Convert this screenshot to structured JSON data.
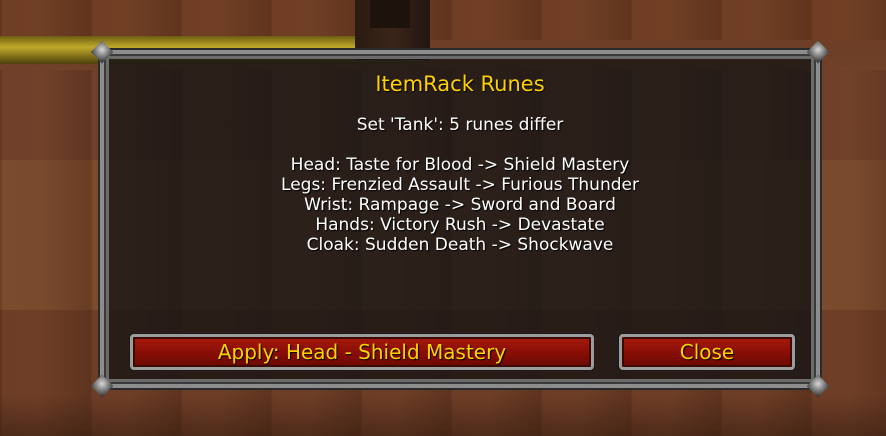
{
  "dialog": {
    "title": "ItemRack Runes",
    "subtitle": "Set 'Tank': 5 runes differ",
    "rune_changes": [
      "Head: Taste for Blood -> Shield Mastery",
      "Legs: Frenzied Assault -> Furious Thunder",
      "Wrist: Rampage -> Sword and Board",
      "Hands: Victory Rush -> Devastate",
      "Cloak: Sudden Death -> Shockwave"
    ],
    "buttons": {
      "apply_label": "Apply: Head - Shield Mastery",
      "close_label": "Close"
    }
  },
  "colors": {
    "title": "#ffd100",
    "text": "#ffffff",
    "button_fill": "#8d0f06",
    "button_text": "#ffd100",
    "frame": "#8d8d8d"
  }
}
